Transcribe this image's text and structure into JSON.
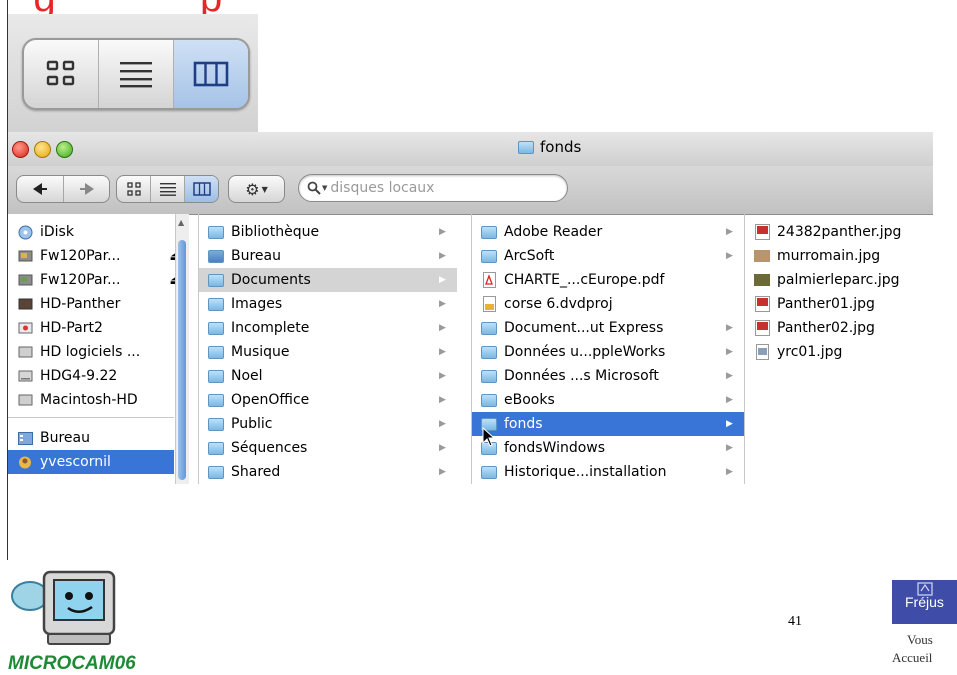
{
  "slide": {
    "title_partial": "   g             p",
    "page_number": "41"
  },
  "window": {
    "title": "fonds"
  },
  "toolbar": {
    "search_placeholder": "disques locaux",
    "active_view": "column"
  },
  "sidebar": {
    "items": [
      {
        "label": "iDisk",
        "icon": "idisk-icon"
      },
      {
        "label": "Fw120Par...",
        "icon": "disk-icon",
        "eject": true
      },
      {
        "label": "Fw120Par...",
        "icon": "disk-icon",
        "eject": true
      },
      {
        "label": "HD-Panther",
        "icon": "disk-icon"
      },
      {
        "label": "HD-Part2",
        "icon": "disk-icon"
      },
      {
        "label": "HD logiciels ...",
        "icon": "disk-icon"
      },
      {
        "label": "HDG4-9.22",
        "icon": "disk-icon"
      },
      {
        "label": "Macintosh-HD",
        "icon": "disk-icon"
      },
      {
        "label": "Bureau",
        "icon": "desktop-icon"
      },
      {
        "label": "yvescornil",
        "icon": "home-icon",
        "selected": true
      }
    ]
  },
  "column1": {
    "items": [
      {
        "label": "Bibliothèque"
      },
      {
        "label": "Bureau"
      },
      {
        "label": "Documents",
        "selected": true
      },
      {
        "label": "Images"
      },
      {
        "label": "Incomplete"
      },
      {
        "label": "Musique"
      },
      {
        "label": "Noel"
      },
      {
        "label": "OpenOffice"
      },
      {
        "label": "Public"
      },
      {
        "label": "Séquences"
      },
      {
        "label": "Shared"
      }
    ]
  },
  "column2": {
    "items": [
      {
        "label": "Adobe Reader",
        "arrow": true
      },
      {
        "label": "ArcSoft",
        "arrow": true
      },
      {
        "label": "CHARTE_...cEurope.pdf",
        "arrow": false
      },
      {
        "label": "corse 6.dvdproj",
        "arrow": false
      },
      {
        "label": "Document...ut Express",
        "arrow": true
      },
      {
        "label": "Données u...ppleWorks",
        "arrow": true
      },
      {
        "label": "Données ...s Microsoft",
        "arrow": true
      },
      {
        "label": "eBooks",
        "arrow": true
      },
      {
        "label": "fonds",
        "arrow": true,
        "selected": true
      },
      {
        "label": "fondsWindows",
        "arrow": true
      },
      {
        "label": "Historique...installation",
        "arrow": true
      }
    ]
  },
  "column3": {
    "items": [
      {
        "label": "24382panther.jpg"
      },
      {
        "label": "murromain.jpg"
      },
      {
        "label": "palmierleparc.jpg"
      },
      {
        "label": "Panther01.jpg"
      },
      {
        "label": "Panther02.jpg"
      },
      {
        "label": "yrc01.jpg"
      }
    ]
  },
  "footer": {
    "logo_text": "MICROCAM06",
    "badge_title": "Fréjus",
    "badge_line1": "Vous",
    "badge_line2": "Accueil"
  },
  "colors": {
    "accent_red": "#e8262a",
    "selection_blue": "#3875d7",
    "badge_blue": "#3f4da8",
    "logo_green": "#1f8a35"
  }
}
